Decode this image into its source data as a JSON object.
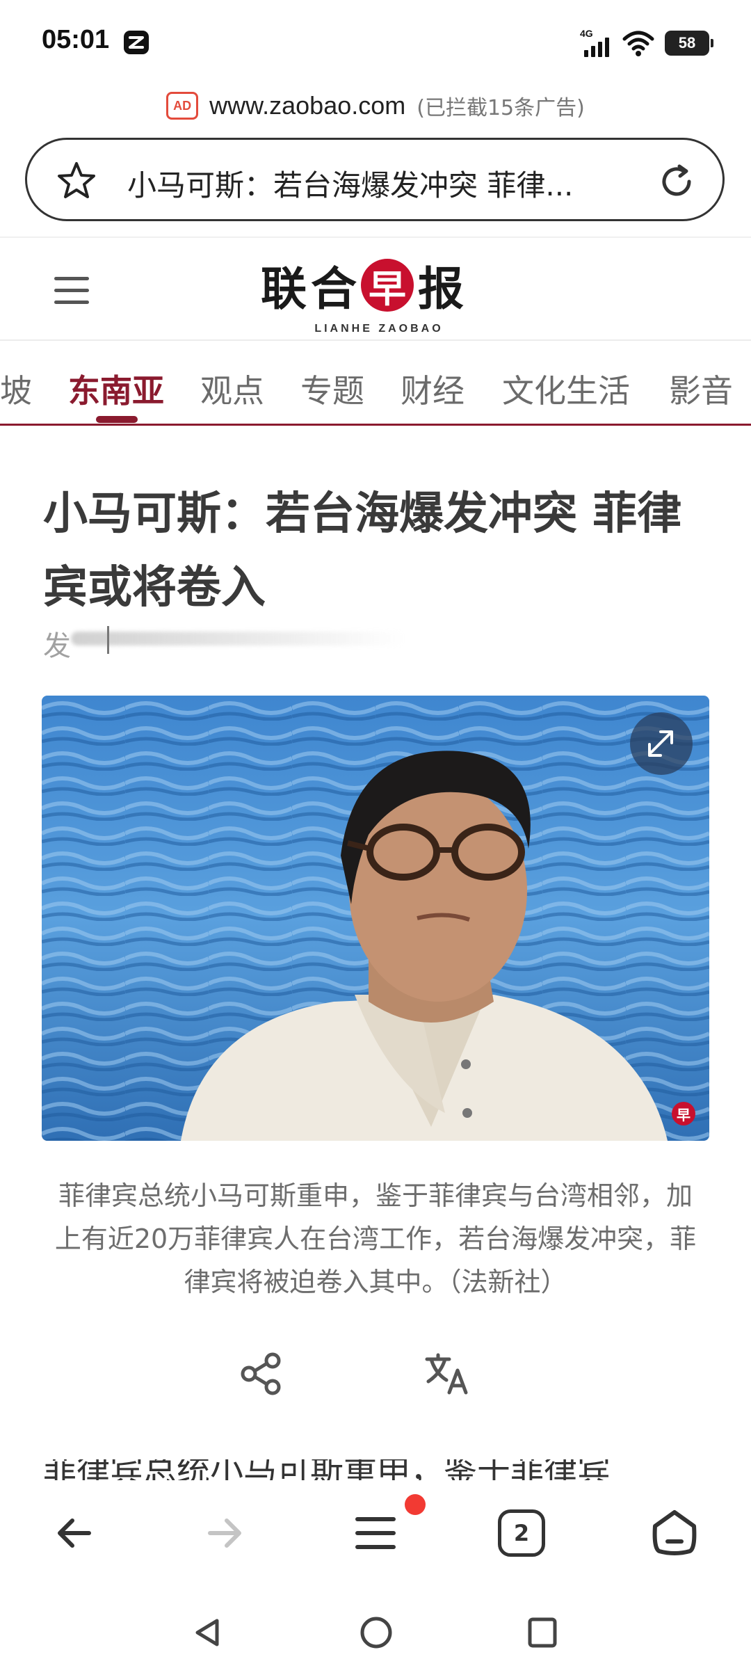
{
  "status": {
    "time": "05:01",
    "network": "4G",
    "battery": "58"
  },
  "browser": {
    "url_domain": "www.zaobao.com",
    "ads_blocked": "(已拦截15条广告)",
    "ad_icon_text": "AD",
    "page_title": "小马可斯：若台海爆发冲突 菲律...",
    "tabs_count": "2"
  },
  "site": {
    "logo_chars": [
      "联",
      "合",
      "早",
      "报"
    ],
    "logo_en": "LIANHE ZAOBAO",
    "categories": [
      "坡",
      "东南亚",
      "观点",
      "专题",
      "财经",
      "文化生活",
      "影音"
    ],
    "active_category": "东南亚",
    "watermark": "早"
  },
  "article": {
    "headline": "小马可斯：若台海爆发冲突 菲律宾或将卷入",
    "byline_partial": "发",
    "caption": "菲律宾总统小马可斯重申，鉴于菲律宾与台湾相邻，加上有近20万菲律宾人在台湾工作，若台海爆发冲突，菲律宾将被迫卷入其中。（法新社）",
    "body_first_line": "菲律宾总统小马可斯重申，鉴于菲律宾"
  },
  "colors": {
    "brand": "#8a1a2e",
    "logo_red": "#c8102e",
    "notify_dot": "#f23a33"
  },
  "icons": [
    "star-icon",
    "reload-icon",
    "menu-icon",
    "expand-icon",
    "share-icon",
    "translate-icon",
    "back-icon",
    "forward-icon",
    "browser-menu-icon",
    "tabs-icon",
    "home-icon",
    "nav-back-icon",
    "nav-home-icon",
    "nav-recents-icon"
  ]
}
